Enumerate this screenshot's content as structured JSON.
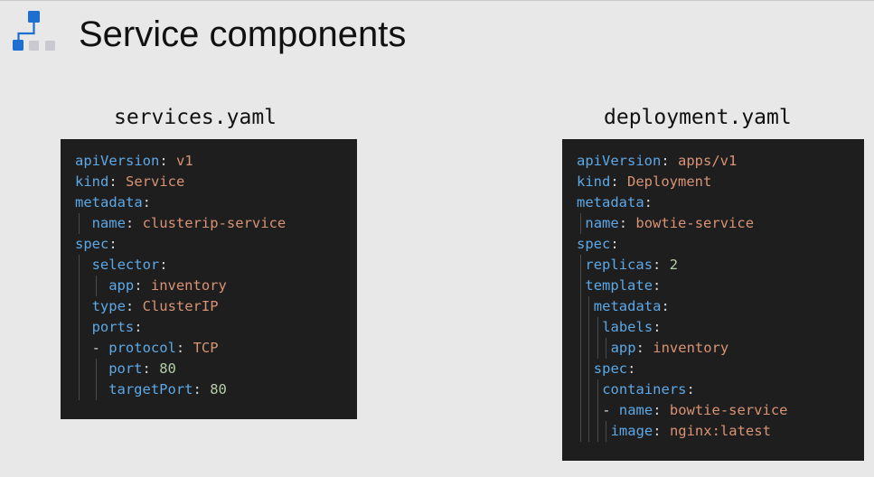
{
  "slide": {
    "title": "Service components",
    "logo_icon": "workflow-icon",
    "colors": {
      "background": "#e8e8e8",
      "code_background": "#1e1e1e",
      "key": "#5da8e6",
      "string": "#d99375",
      "number": "#b5cea8",
      "punctuation": "#d4d4d4",
      "logo_primary": "#1f6fd1",
      "logo_muted": "#c9c9cf"
    }
  },
  "left_panel": {
    "filename": "services.yaml",
    "lines": [
      {
        "indent": 0,
        "dash": false,
        "key": "apiVersion",
        "value": "v1",
        "type": "string"
      },
      {
        "indent": 0,
        "dash": false,
        "key": "kind",
        "value": "Service",
        "type": "string"
      },
      {
        "indent": 0,
        "dash": false,
        "key": "metadata",
        "value": "",
        "type": ""
      },
      {
        "indent": 1,
        "dash": false,
        "key": "name",
        "value": "clusterip-service",
        "type": "string"
      },
      {
        "indent": 0,
        "dash": false,
        "key": "spec",
        "value": "",
        "type": ""
      },
      {
        "indent": 1,
        "dash": false,
        "key": "selector",
        "value": "",
        "type": ""
      },
      {
        "indent": 2,
        "dash": false,
        "key": "app",
        "value": "inventory",
        "type": "string"
      },
      {
        "indent": 1,
        "dash": false,
        "key": "type",
        "value": "ClusterIP",
        "type": "string"
      },
      {
        "indent": 1,
        "dash": false,
        "key": "ports",
        "value": "",
        "type": ""
      },
      {
        "indent": 1,
        "dash": true,
        "key": "protocol",
        "value": "TCP",
        "type": "string"
      },
      {
        "indent": 2,
        "dash": false,
        "key": "port",
        "value": "80",
        "type": "number"
      },
      {
        "indent": 2,
        "dash": false,
        "key": "targetPort",
        "value": "80",
        "type": "number"
      }
    ]
  },
  "right_panel": {
    "filename": "deployment.yaml",
    "lines": [
      {
        "indent": 0,
        "dash": false,
        "key": "apiVersion",
        "value": "apps/v1",
        "type": "string"
      },
      {
        "indent": 0,
        "dash": false,
        "key": "kind",
        "value": "Deployment",
        "type": "string"
      },
      {
        "indent": 0,
        "dash": false,
        "key": "metadata",
        "value": "",
        "type": ""
      },
      {
        "indent": 1,
        "dash": false,
        "key": "name",
        "value": "bowtie-service",
        "type": "string"
      },
      {
        "indent": 0,
        "dash": false,
        "key": "spec",
        "value": "",
        "type": ""
      },
      {
        "indent": 1,
        "dash": false,
        "key": "replicas",
        "value": "2",
        "type": "number"
      },
      {
        "indent": 1,
        "dash": false,
        "key": "template",
        "value": "",
        "type": ""
      },
      {
        "indent": 2,
        "dash": false,
        "key": "metadata",
        "value": "",
        "type": ""
      },
      {
        "indent": 3,
        "dash": false,
        "key": "labels",
        "value": "",
        "type": ""
      },
      {
        "indent": 4,
        "dash": false,
        "key": "app",
        "value": "inventory",
        "type": "string"
      },
      {
        "indent": 2,
        "dash": false,
        "key": "spec",
        "value": "",
        "type": ""
      },
      {
        "indent": 3,
        "dash": false,
        "key": "containers",
        "value": "",
        "type": ""
      },
      {
        "indent": 3,
        "dash": true,
        "key": "name",
        "value": "bowtie-service",
        "type": "string"
      },
      {
        "indent": 4,
        "dash": false,
        "key": "image",
        "value": "nginx:latest",
        "type": "string"
      }
    ]
  }
}
